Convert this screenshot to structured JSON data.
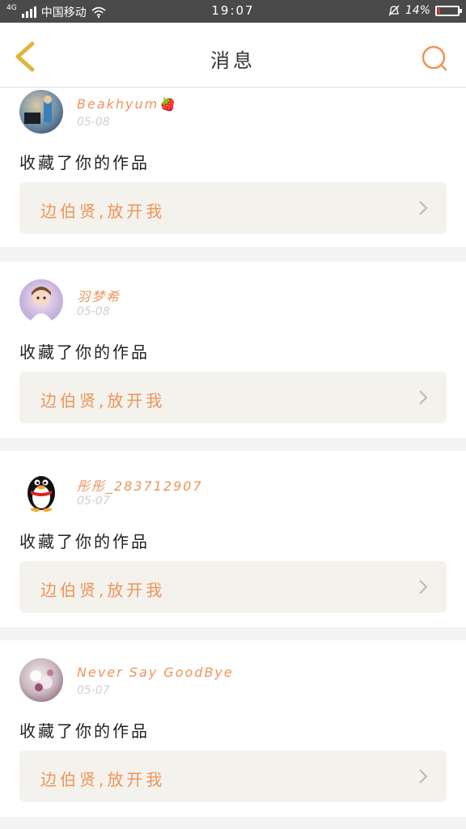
{
  "status_bar": {
    "network": "4G",
    "carrier": "中国移动",
    "time": "19:07",
    "battery": "14%",
    "battery_level": 0.14,
    "battery_color": "#e53935"
  },
  "nav": {
    "title": "消息"
  },
  "messages": [
    {
      "username": "Beakhyum🍓",
      "date": "05-08",
      "action": "收藏了你的作品",
      "work_title": "边伯贤,放开我"
    },
    {
      "username": "羽梦希",
      "date": "05-08",
      "action": "收藏了你的作品",
      "work_title": "边伯贤,放开我"
    },
    {
      "username": "彤彤_283712907",
      "date": "05-07",
      "action": "收藏了你的作品",
      "work_title": "边伯贤,放开我"
    },
    {
      "username": "Never Say GoodBye",
      "date": "05-07",
      "action": "收藏了你的作品",
      "work_title": "边伯贤,放开我"
    }
  ],
  "colors": {
    "accent": "#f0935a",
    "back_icon": "#e0b53a",
    "link_background": "#f3f2ec"
  }
}
